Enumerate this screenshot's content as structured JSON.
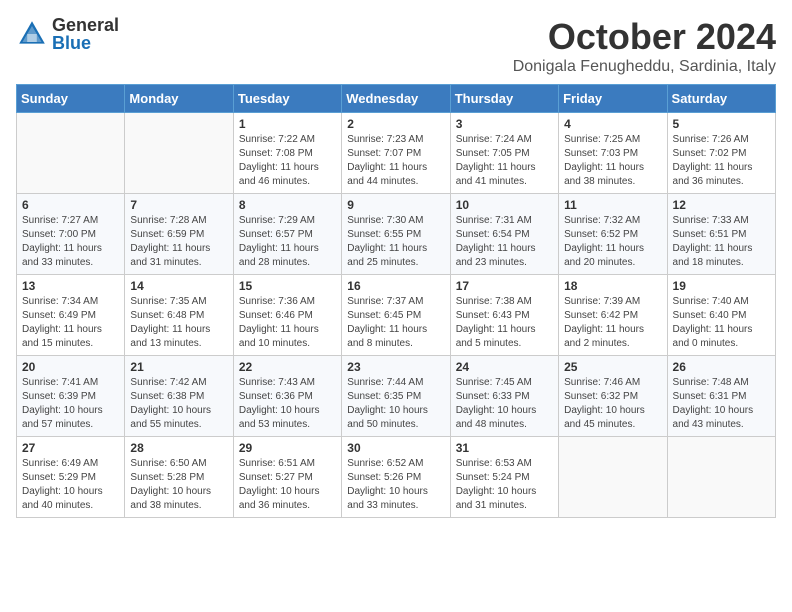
{
  "logo": {
    "general": "General",
    "blue": "Blue"
  },
  "title": "October 2024",
  "location": "Donigala Fenugheddu, Sardinia, Italy",
  "days_of_week": [
    "Sunday",
    "Monday",
    "Tuesday",
    "Wednesday",
    "Thursday",
    "Friday",
    "Saturday"
  ],
  "weeks": [
    [
      {
        "day": "",
        "info": ""
      },
      {
        "day": "",
        "info": ""
      },
      {
        "day": "1",
        "info": "Sunrise: 7:22 AM\nSunset: 7:08 PM\nDaylight: 11 hours and 46 minutes."
      },
      {
        "day": "2",
        "info": "Sunrise: 7:23 AM\nSunset: 7:07 PM\nDaylight: 11 hours and 44 minutes."
      },
      {
        "day": "3",
        "info": "Sunrise: 7:24 AM\nSunset: 7:05 PM\nDaylight: 11 hours and 41 minutes."
      },
      {
        "day": "4",
        "info": "Sunrise: 7:25 AM\nSunset: 7:03 PM\nDaylight: 11 hours and 38 minutes."
      },
      {
        "day": "5",
        "info": "Sunrise: 7:26 AM\nSunset: 7:02 PM\nDaylight: 11 hours and 36 minutes."
      }
    ],
    [
      {
        "day": "6",
        "info": "Sunrise: 7:27 AM\nSunset: 7:00 PM\nDaylight: 11 hours and 33 minutes."
      },
      {
        "day": "7",
        "info": "Sunrise: 7:28 AM\nSunset: 6:59 PM\nDaylight: 11 hours and 31 minutes."
      },
      {
        "day": "8",
        "info": "Sunrise: 7:29 AM\nSunset: 6:57 PM\nDaylight: 11 hours and 28 minutes."
      },
      {
        "day": "9",
        "info": "Sunrise: 7:30 AM\nSunset: 6:55 PM\nDaylight: 11 hours and 25 minutes."
      },
      {
        "day": "10",
        "info": "Sunrise: 7:31 AM\nSunset: 6:54 PM\nDaylight: 11 hours and 23 minutes."
      },
      {
        "day": "11",
        "info": "Sunrise: 7:32 AM\nSunset: 6:52 PM\nDaylight: 11 hours and 20 minutes."
      },
      {
        "day": "12",
        "info": "Sunrise: 7:33 AM\nSunset: 6:51 PM\nDaylight: 11 hours and 18 minutes."
      }
    ],
    [
      {
        "day": "13",
        "info": "Sunrise: 7:34 AM\nSunset: 6:49 PM\nDaylight: 11 hours and 15 minutes."
      },
      {
        "day": "14",
        "info": "Sunrise: 7:35 AM\nSunset: 6:48 PM\nDaylight: 11 hours and 13 minutes."
      },
      {
        "day": "15",
        "info": "Sunrise: 7:36 AM\nSunset: 6:46 PM\nDaylight: 11 hours and 10 minutes."
      },
      {
        "day": "16",
        "info": "Sunrise: 7:37 AM\nSunset: 6:45 PM\nDaylight: 11 hours and 8 minutes."
      },
      {
        "day": "17",
        "info": "Sunrise: 7:38 AM\nSunset: 6:43 PM\nDaylight: 11 hours and 5 minutes."
      },
      {
        "day": "18",
        "info": "Sunrise: 7:39 AM\nSunset: 6:42 PM\nDaylight: 11 hours and 2 minutes."
      },
      {
        "day": "19",
        "info": "Sunrise: 7:40 AM\nSunset: 6:40 PM\nDaylight: 11 hours and 0 minutes."
      }
    ],
    [
      {
        "day": "20",
        "info": "Sunrise: 7:41 AM\nSunset: 6:39 PM\nDaylight: 10 hours and 57 minutes."
      },
      {
        "day": "21",
        "info": "Sunrise: 7:42 AM\nSunset: 6:38 PM\nDaylight: 10 hours and 55 minutes."
      },
      {
        "day": "22",
        "info": "Sunrise: 7:43 AM\nSunset: 6:36 PM\nDaylight: 10 hours and 53 minutes."
      },
      {
        "day": "23",
        "info": "Sunrise: 7:44 AM\nSunset: 6:35 PM\nDaylight: 10 hours and 50 minutes."
      },
      {
        "day": "24",
        "info": "Sunrise: 7:45 AM\nSunset: 6:33 PM\nDaylight: 10 hours and 48 minutes."
      },
      {
        "day": "25",
        "info": "Sunrise: 7:46 AM\nSunset: 6:32 PM\nDaylight: 10 hours and 45 minutes."
      },
      {
        "day": "26",
        "info": "Sunrise: 7:48 AM\nSunset: 6:31 PM\nDaylight: 10 hours and 43 minutes."
      }
    ],
    [
      {
        "day": "27",
        "info": "Sunrise: 6:49 AM\nSunset: 5:29 PM\nDaylight: 10 hours and 40 minutes."
      },
      {
        "day": "28",
        "info": "Sunrise: 6:50 AM\nSunset: 5:28 PM\nDaylight: 10 hours and 38 minutes."
      },
      {
        "day": "29",
        "info": "Sunrise: 6:51 AM\nSunset: 5:27 PM\nDaylight: 10 hours and 36 minutes."
      },
      {
        "day": "30",
        "info": "Sunrise: 6:52 AM\nSunset: 5:26 PM\nDaylight: 10 hours and 33 minutes."
      },
      {
        "day": "31",
        "info": "Sunrise: 6:53 AM\nSunset: 5:24 PM\nDaylight: 10 hours and 31 minutes."
      },
      {
        "day": "",
        "info": ""
      },
      {
        "day": "",
        "info": ""
      }
    ]
  ]
}
